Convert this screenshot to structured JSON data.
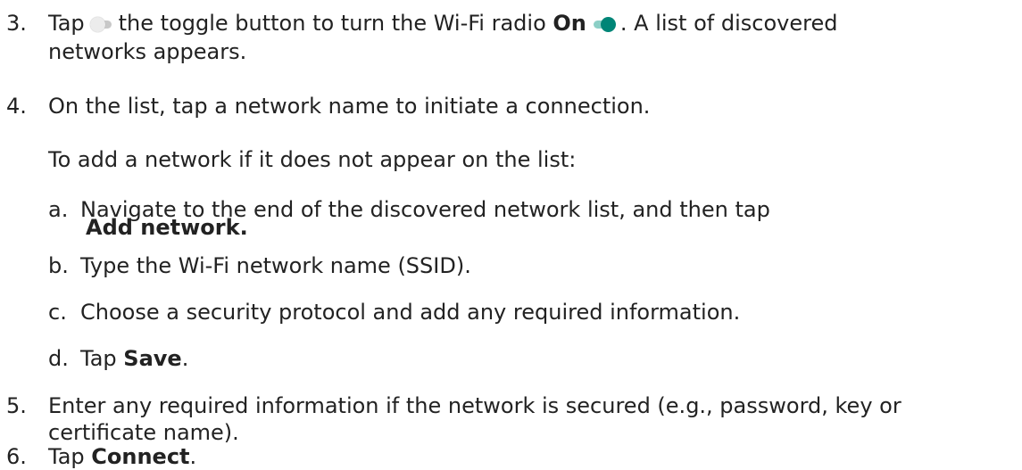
{
  "steps": {
    "s3": {
      "num": "3.",
      "pre": "Tap",
      "mid": "the toggle button to turn the Wi-Fi radio",
      "on": "On",
      "post": ". A list of discovered",
      "cont": "networks appears."
    },
    "s4": {
      "num": "4.",
      "text": "On the list, tap a network name to initiate a connection.",
      "note": "To add a network if it does not appear on the list:",
      "sub": {
        "a": {
          "letter": "a.",
          "text": "Navigate to the end of the discovered network list, and then tap",
          "bold": "Add network."
        },
        "b": {
          "letter": "b.",
          "text": "Type the Wi-Fi network name (SSID)."
        },
        "c": {
          "letter": "c.",
          "text": "Choose a security protocol and add any required information."
        },
        "d": {
          "letter": "d.",
          "pre": "Tap",
          "bold": "Save",
          "post": "."
        }
      }
    },
    "s5": {
      "num": "5.",
      "text": "Enter any required information if the network is secured (e.g., password, key or",
      "cont": "certificate name)."
    },
    "s6": {
      "num": "6.",
      "pre": "Tap",
      "bold": "Connect",
      "post": "."
    }
  },
  "icons": {
    "toggle_off": "toggle-off-icon",
    "toggle_on": "toggle-on-icon"
  },
  "colors": {
    "text": "#222222",
    "toggle_on": "#008577",
    "toggle_on_track": "#8ccfc6",
    "toggle_off_track": "#c8c8c8"
  }
}
